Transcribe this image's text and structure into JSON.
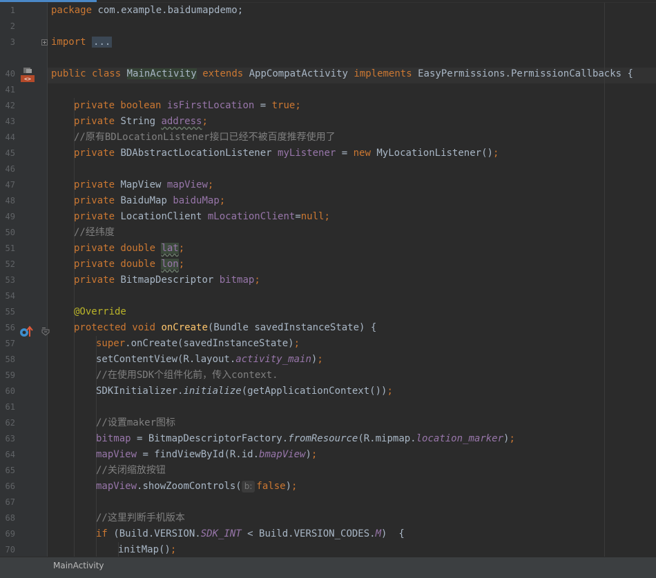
{
  "editor": {
    "line_numbers": [
      "1",
      "2",
      "3",
      "40",
      "41",
      "42",
      "43",
      "44",
      "45",
      "46",
      "47",
      "48",
      "49",
      "50",
      "51",
      "52",
      "53",
      "54",
      "55",
      "56",
      "57",
      "58",
      "59",
      "60",
      "61",
      "62",
      "63",
      "64",
      "65",
      "66",
      "67",
      "68",
      "69",
      "70"
    ],
    "tokens": {
      "t0": "package",
      "t1": " com.example.baidumapdemo;",
      "t2": "import",
      "t3": " ",
      "t4": "...",
      "t5": "public class",
      "t6": " ",
      "t7": "MainActivity",
      "t8": " ",
      "t9": "extends",
      "t10": " AppCompatActivity ",
      "t11": "implements",
      "t12": " EasyPermissions.PermissionCallbacks {",
      "t13": "private boolean",
      "t14": " ",
      "t15": "isFirstLocation",
      "t16": " = ",
      "t17": "true",
      "t18": ";",
      "t19": "private",
      "t20": " String ",
      "t21": "address",
      "t22": ";",
      "t23": "//原有BDLocationListener接口已经不被百度推荐使用了",
      "t24": "private",
      "t25": " BDAbstractLocationListener ",
      "t26": "myListener",
      "t27": " = ",
      "t28": "new",
      "t29": " MyLocationListener()",
      "t30": ";",
      "t31": "private",
      "t32": " MapView ",
      "t33": "mapView",
      "t34": ";",
      "t35": "private",
      "t36": " BaiduMap ",
      "t37": "baiduMap",
      "t38": ";",
      "t39": "private",
      "t40": " LocationClient ",
      "t41": "mLocationClient",
      "t42": "=",
      "t43": "null;",
      "t44": "//经纬度",
      "t45": "private double",
      "t46": " ",
      "t47": "lat",
      "t48": ";",
      "t49": "private double",
      "t50": " ",
      "t51": "lon",
      "t52": ";",
      "t53": "private",
      "t54": " BitmapDescriptor ",
      "t55": "bitmap",
      "t56": ";",
      "t57": "@Override",
      "t58": "protected void",
      "t59": " ",
      "t60": "onCreate",
      "t61": "(Bundle savedInstanceState) {",
      "t62": "super",
      "t63": ".onCreate(savedInstanceState)",
      "t64": ";",
      "t65": "setContentView(R.layout.",
      "t66": "activity_main",
      "t67": ")",
      "t68": ";",
      "t69": "//在使用SDK个组件化前，传入context.",
      "t70": "SDKInitializer.",
      "t71": "initialize",
      "t72": "(getApplicationContext())",
      "t73": ";",
      "t74": "//设置maker图标",
      "t75": "bitmap",
      "t76": " = BitmapDescriptorFactory.",
      "t77": "fromResource",
      "t78": "(R.mipmap.",
      "t79": "location_marker",
      "t80": ")",
      "t81": ";",
      "t82": "mapView",
      "t83": " = findViewById(R.id.",
      "t84": "bmapView",
      "t85": ")",
      "t86": ";",
      "t87": "//关闭缩放按钮",
      "t88": "mapView",
      "t89": ".showZoomControls(",
      "t90": "b:",
      "t91": "false",
      "t92": ")",
      "t93": ";",
      "t94": "//这里判断手机版本",
      "t95": "if",
      "t96": " (Build.VERSION.",
      "t97": "SDK_INT",
      "t98": " < Build.VERSION_CODES.",
      "t99": "M",
      "t100": ")  {",
      "t101": "initMap()",
      "t102": ";"
    }
  },
  "gutter_icons": {
    "implements_icon": "implements-gutter-icon",
    "override_icon": "overrides-method-gutter-icon"
  },
  "status_bar": {
    "breadcrumb": "MainActivity"
  },
  "colors": {
    "background": "#2b2b2b",
    "keyword": "#cc7832",
    "field": "#9876aa",
    "comment": "#808080",
    "annotation": "#bbb529",
    "method_decl": "#ffc66d",
    "plain": "#a9b7c6"
  }
}
